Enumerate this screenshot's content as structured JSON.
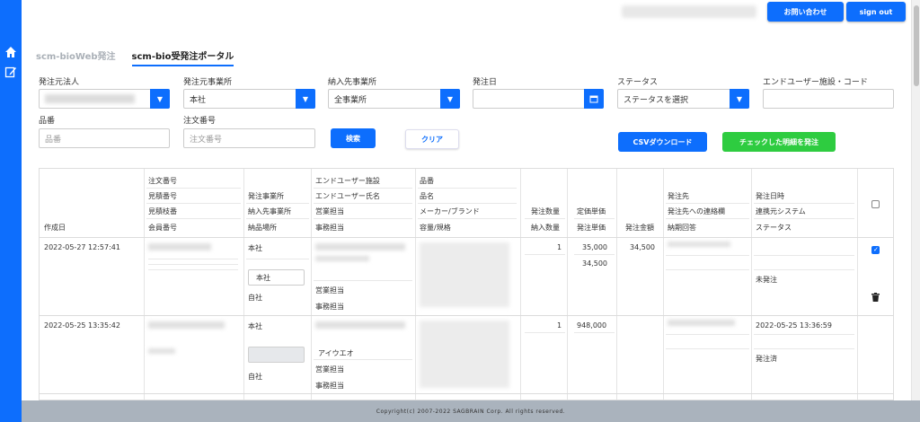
{
  "sidebar": {
    "icons": [
      "home-icon",
      "edit-icon"
    ]
  },
  "header": {
    "contact_label": "お問い合わせ",
    "signout_label": "sign out"
  },
  "tabs": [
    {
      "label": "scm-bioWeb発注",
      "active": false
    },
    {
      "label": "scm-bio受発注ポータル",
      "active": true
    }
  ],
  "filters": {
    "orderer_corp_label": "発注元法人",
    "orderer_site_label": "発注元事業所",
    "orderer_site_value": "本社",
    "dest_site_label": "納入先事業所",
    "dest_site_value": "全事業所",
    "order_date_label": "発注日",
    "status_label": "ステータス",
    "status_value": "ステータスを選択",
    "enduser_label": "エンドユーザー施設・コード",
    "item_label": "品番",
    "item_placeholder": "品番",
    "order_no_label": "注文番号",
    "order_no_placeholder": "注文番号",
    "search_label": "検索",
    "clear_label": "クリア",
    "csv_label": "CSVダウンロード",
    "order_checked_label": "チェックした明細を発注"
  },
  "table": {
    "headers": {
      "created": "作成日",
      "order_no": [
        "注文番号",
        "見積番号",
        "見積枝番",
        "会員番号"
      ],
      "site": [
        "発注事業所",
        "納入先事業所",
        "納品場所"
      ],
      "enduser": [
        "エンドユーザー施設",
        "エンドユーザー氏名",
        "営業担当",
        "事務担当"
      ],
      "product": [
        "品番",
        "品名",
        "メーカー/ブランド",
        "容量/規格"
      ],
      "qty": [
        "発注数量",
        "納入数量"
      ],
      "price": [
        "定価単価",
        "発注単価"
      ],
      "amount": "発注金額",
      "supplier": [
        "発注先",
        "発注先への連絡欄",
        "納期回答"
      ],
      "dates": [
        "発注日時",
        "連携元システム",
        "ステータス"
      ]
    },
    "rows": [
      {
        "created": "2022-05-27 12:57:41",
        "order_site": "本社",
        "delivery_site": "本社",
        "place": "自社",
        "sales": "営業担当",
        "clerk": "事務担当",
        "qty": "1",
        "list_price": "35,000",
        "order_price": "34,500",
        "amount": "34,500",
        "status": "未発注",
        "checked": true
      },
      {
        "created": "2022-05-25 13:35:42",
        "order_site": "本社",
        "place": "自社",
        "enduser_name": "アイウエオ",
        "sales": "営業担当",
        "clerk": "事務担当",
        "qty": "1",
        "list_price": "948,000",
        "order_datetime": "2022-05-25 13:36:59",
        "status": "発注済",
        "checked": false
      }
    ]
  },
  "footer": {
    "copyright": "Copyright(c) 2007-2022 SAGBRAIN Corp. All rights reserved."
  }
}
